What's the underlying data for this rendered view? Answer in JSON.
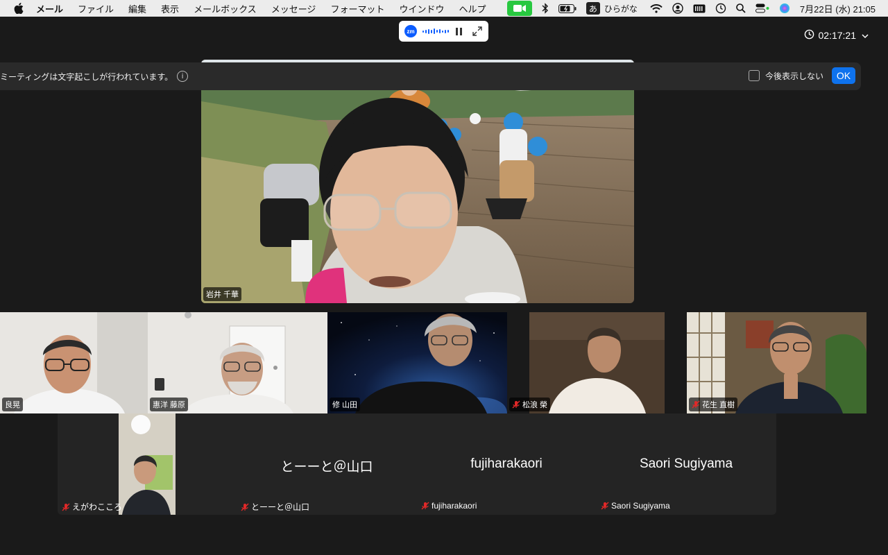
{
  "menubar": {
    "app_name": "メール",
    "items": [
      "ファイル",
      "編集",
      "表示",
      "メールボックス",
      "メッセージ",
      "フォーマット",
      "ウインドウ",
      "ヘルプ"
    ],
    "ime_char": "あ",
    "ime_label": "ひらがな",
    "datetime": "7月22日 (水)  21:05"
  },
  "topbar": {
    "zoom_logo": "zm",
    "timer": "02:17:21"
  },
  "banner": {
    "message": "ミーティングは文字起こしが行われています。",
    "info_glyph": "i",
    "checkbox_label": "今後表示しない",
    "ok_label": "OK"
  },
  "speaker": {
    "name": "岩井 千華"
  },
  "gallery": [
    {
      "name": "良晃",
      "muted": false
    },
    {
      "name": "惠洋 藤原",
      "muted": false
    },
    {
      "name": "修 山田",
      "muted": false
    },
    {
      "name": "松浪 榮",
      "muted": true
    },
    {
      "name": "花生 直樹",
      "muted": true
    }
  ],
  "bottom_row": [
    {
      "display": "",
      "label": "えがわこころ",
      "muted": true
    },
    {
      "display": "とーーと＠山口",
      "label": "とーーと＠山口",
      "muted": true
    },
    {
      "display": "fujiharakaori",
      "label": "fujiharakaori",
      "muted": true
    },
    {
      "display": "Saori Sugiyama",
      "label": "Saori Sugiyama",
      "muted": true
    }
  ],
  "colors": {
    "accent": "#0e72ed",
    "mute": "#e02828",
    "camera_green": "#28c840"
  }
}
